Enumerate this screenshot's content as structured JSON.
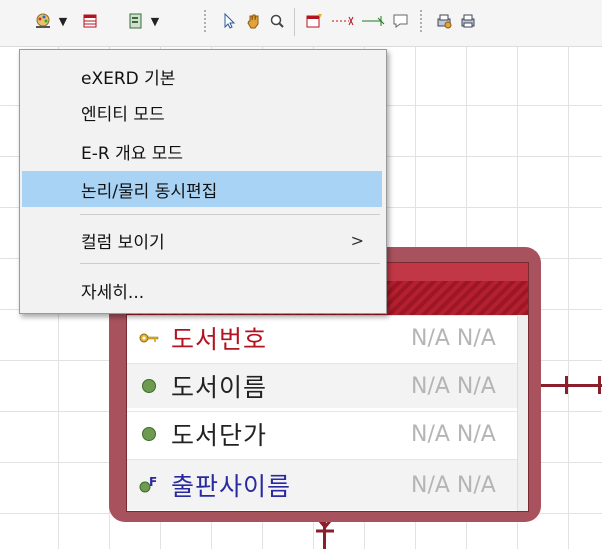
{
  "toolbar": {
    "icons": [
      "palette-icon",
      "table-icon",
      "notebook-icon",
      "pointer-icon",
      "hand-icon",
      "magnify-icon",
      "new-entity-icon",
      "relation-nonidentifying-icon",
      "relation-identifying-icon",
      "note-icon",
      "print-setup-icon",
      "print-icon"
    ]
  },
  "menu": {
    "items": [
      {
        "label": "eXERD 기본"
      },
      {
        "label": "엔티티 모드"
      },
      {
        "label": "E-R 개요 모드"
      },
      {
        "label": "논리/물리 동시편집"
      },
      {
        "label": "컬럼 보이기",
        "arrow": ">"
      },
      {
        "label": "자세히..."
      }
    ]
  },
  "entity": {
    "attributes": [
      {
        "name": "도서번호",
        "type": "N/A N/A",
        "kind": "pk"
      },
      {
        "name": "도서이름",
        "type": "N/A N/A",
        "kind": "normal"
      },
      {
        "name": "도서단가",
        "type": "N/A N/A",
        "kind": "normal"
      },
      {
        "name": "출판사이름",
        "type": "N/A N/A",
        "kind": "fk"
      }
    ]
  },
  "colors": {
    "entity_border": "#a8525d",
    "entity_header": "#b4202e",
    "menu_highlight": "#a9d3f5",
    "pk_text": "#b3131f",
    "fk_text": "#2a2aa0"
  }
}
